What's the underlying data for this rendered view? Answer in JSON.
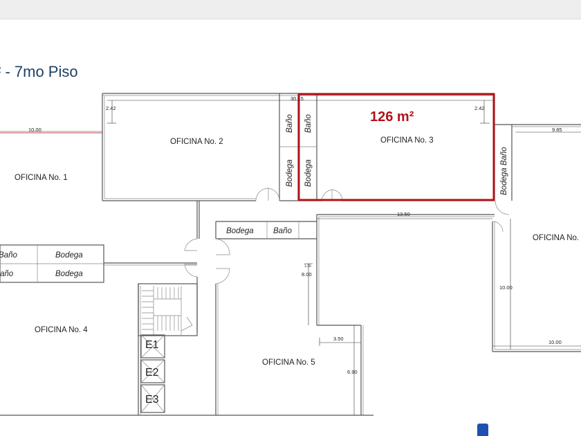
{
  "page": {
    "title": "² - 7mo Piso"
  },
  "plan": {
    "highlight": {
      "area": "126 m²",
      "color": "#b01319"
    },
    "rooms": {
      "oficina1": "OFICINA No. 1",
      "oficina2": "OFICINA No. 2",
      "oficina3": "OFICINA No. 3",
      "oficina4": "OFICINA No. 4",
      "oficina5": "OFICINA No. 5",
      "oficina6": "OFICINA No."
    },
    "labels": {
      "bano": "Baño",
      "bodega": "Bodega",
      "bano_partial": "año",
      "bodega_bano": "Bodega Baño"
    },
    "elevators": [
      "E1",
      "E2",
      "E3"
    ],
    "dimensions": {
      "d_10_00_left": "10.00",
      "d_2_42_left": "2.42",
      "d_30_15": "30.15",
      "d_2_42_right": "2.42",
      "d_9_85": "9.85",
      "d_13_50": "13.50",
      "d_1_35": "1.35",
      "d_8_00": "8.00",
      "d_10_00_vert": "10.00",
      "d_3_50": "3.50",
      "d_6_90": "6.90",
      "d_10_00_right": "10.00"
    }
  }
}
